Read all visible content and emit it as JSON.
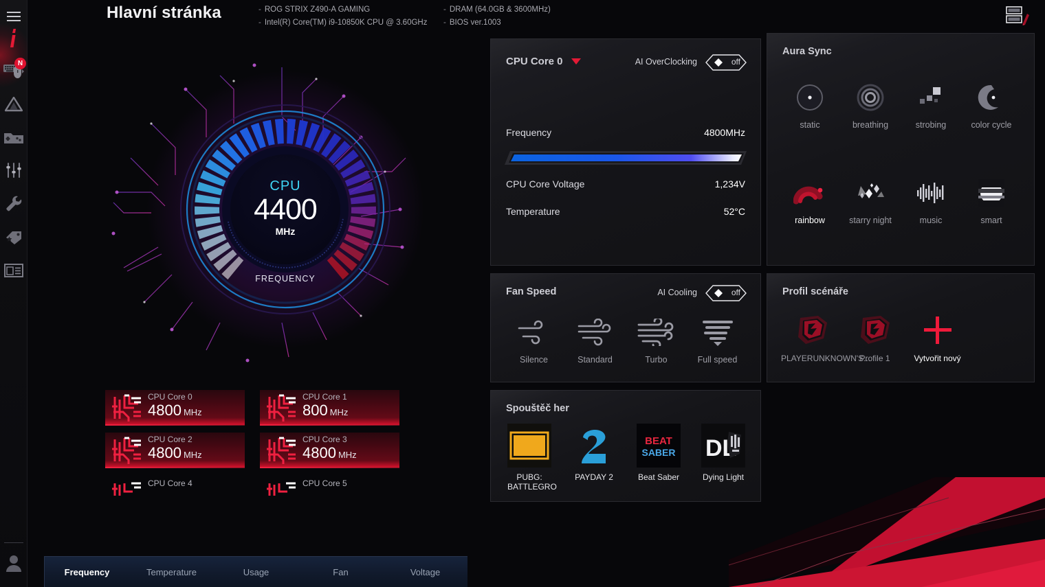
{
  "header": {
    "title": "Hlavní stránka",
    "sysinfo_col1": [
      "ROG STRIX Z490-A GAMING",
      "Intel(R) Core(TM) i9-10850K CPU @ 3.60GHz"
    ],
    "sysinfo_col2": [
      "DRAM (64.0GB & 3600MHz)",
      "BIOS ver.1003"
    ],
    "edit_layout_icon": "edit-layout-icon"
  },
  "sidebar": {
    "items": [
      {
        "name": "menu-icon",
        "label": "menu"
      },
      {
        "name": "home-icon",
        "label": "home"
      },
      {
        "name": "devices-icon",
        "label": "devices",
        "badge": "N"
      },
      {
        "name": "aura-icon",
        "label": "aura"
      },
      {
        "name": "game-library-icon",
        "label": "game library"
      },
      {
        "name": "tuning-icon",
        "label": "tuning"
      },
      {
        "name": "tools-icon",
        "label": "tools"
      },
      {
        "name": "deals-icon",
        "label": "deals"
      },
      {
        "name": "news-icon",
        "label": "news"
      },
      {
        "name": "account-icon",
        "label": "account"
      }
    ]
  },
  "gauge": {
    "metric": "CPU",
    "value": "4400",
    "unit": "MHz",
    "label": "FREQUENCY",
    "accent": "#3fd5f5"
  },
  "cores": [
    {
      "name": "CPU Core 0",
      "freq": "4800",
      "unit": "MHz",
      "active": true
    },
    {
      "name": "CPU Core 1",
      "freq": "800",
      "unit": "MHz",
      "active": true
    },
    {
      "name": "CPU Core 2",
      "freq": "4800",
      "unit": "MHz",
      "active": true
    },
    {
      "name": "CPU Core 3",
      "freq": "4800",
      "unit": "MHz",
      "active": true
    },
    {
      "name": "CPU Core 4",
      "freq": "",
      "unit": "",
      "active": false
    },
    {
      "name": "CPU Core 5",
      "freq": "",
      "unit": "",
      "active": false
    }
  ],
  "tabs": [
    {
      "label": "Frequency",
      "active": true
    },
    {
      "label": "Temperature",
      "active": false
    },
    {
      "label": "Usage",
      "active": false
    },
    {
      "label": "Fan",
      "active": false
    },
    {
      "label": "Voltage",
      "active": false
    }
  ],
  "cpu_core_panel": {
    "selected_core": "CPU Core 0",
    "ai_overclocking_label": "AI OverClocking",
    "ai_overclocking_state": "off",
    "rows": [
      {
        "key": "Frequency",
        "value": "4800MHz"
      },
      {
        "key": "CPU Core Voltage",
        "value": "1,234V"
      },
      {
        "key": "Temperature",
        "value": "52°C"
      }
    ],
    "frequency_bar_percent": 92
  },
  "aura_sync": {
    "title": "Aura Sync",
    "modes": [
      {
        "label": "static",
        "icon": "static-icon",
        "selected": false
      },
      {
        "label": "breathing",
        "icon": "breathing-icon",
        "selected": false
      },
      {
        "label": "strobing",
        "icon": "strobing-icon",
        "selected": false
      },
      {
        "label": "color cycle",
        "icon": "color-cycle-icon",
        "selected": false
      },
      {
        "label": "rainbow",
        "icon": "rainbow-icon",
        "selected": true
      },
      {
        "label": "starry night",
        "icon": "starry-night-icon",
        "selected": false
      },
      {
        "label": "music",
        "icon": "music-icon",
        "selected": false
      },
      {
        "label": "smart",
        "icon": "smart-icon",
        "selected": false
      }
    ]
  },
  "fan_speed": {
    "title": "Fan Speed",
    "ai_cooling_label": "AI Cooling",
    "ai_cooling_state": "off",
    "modes": [
      {
        "label": "Silence",
        "icon": "wind-1-icon"
      },
      {
        "label": "Standard",
        "icon": "wind-2-icon"
      },
      {
        "label": "Turbo",
        "icon": "wind-3-icon"
      },
      {
        "label": "Full speed",
        "icon": "wind-full-icon"
      }
    ]
  },
  "scenario_profile": {
    "title": "Profil scénáře",
    "items": [
      {
        "label": "PLAYERUNKNOWN'S...",
        "icon": "rog-profile-icon",
        "is_new": false
      },
      {
        "label": "Profile 1",
        "icon": "rog-profile-icon",
        "is_new": false
      },
      {
        "label": "Vytvořit nový",
        "icon": "plus-icon",
        "is_new": true
      }
    ]
  },
  "game_launcher": {
    "title": "Spouštěč her",
    "games": [
      {
        "label": "PUBG: BATTLEGRO",
        "icon": "pubg-icon"
      },
      {
        "label": "PAYDAY 2",
        "icon": "payday2-icon"
      },
      {
        "label": "Beat Saber",
        "icon": "beat-saber-icon"
      },
      {
        "label": "Dying Light",
        "icon": "dying-light-icon"
      }
    ]
  },
  "colors": {
    "accent_red": "#e31a35",
    "panel_bg": "#151519",
    "gauge_cyan": "#3fd5f5"
  }
}
